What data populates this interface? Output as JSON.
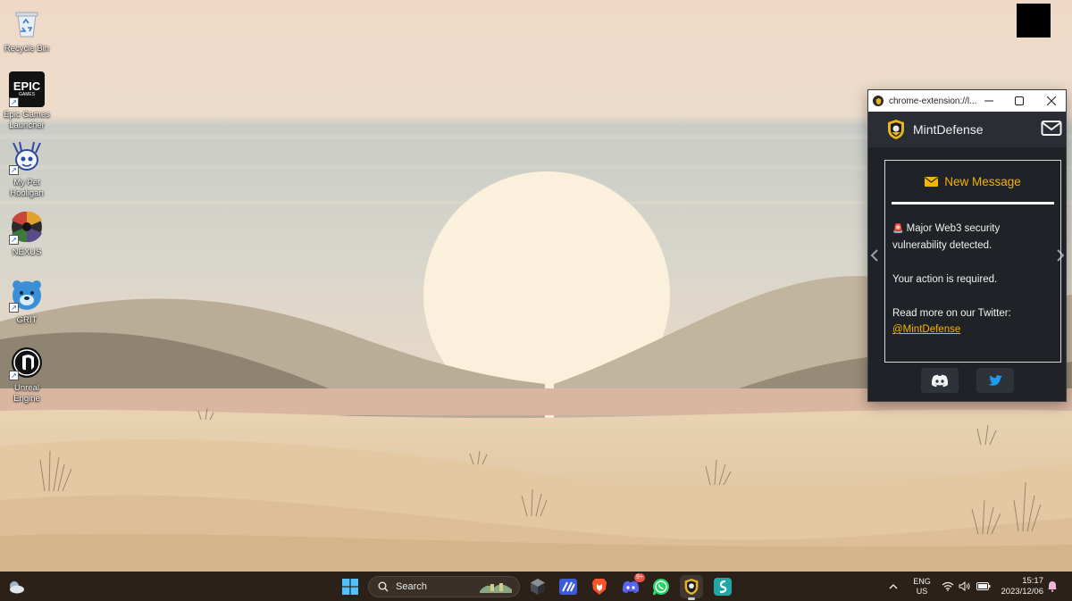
{
  "desktop": {
    "icons": [
      {
        "label": "Recycle Bin",
        "icon": "recycle-bin-icon"
      },
      {
        "label": "Epic Games Launcher",
        "icon": "epic-games-icon"
      },
      {
        "label": "My Pet Hooligan",
        "icon": "pet-hooligan-icon"
      },
      {
        "label": "NEXUS",
        "icon": "nexus-icon"
      },
      {
        "label": "GRIT",
        "icon": "grit-icon"
      },
      {
        "label": "Unreal Engine",
        "icon": "unreal-engine-icon"
      }
    ],
    "epic_tile_text": "EPIC",
    "epic_tile_sub": "GAMES"
  },
  "extension_window": {
    "title": "chrome-extension://l...",
    "header": {
      "brand": "MintDefense"
    },
    "card": {
      "heading": "New Message",
      "alert_icon": "🚨",
      "line1": "Major Web3 security vulnerability detected.",
      "line2": "Your action is required.",
      "line3": "Read more on our Twitter:",
      "twitter_handle": "@MintDefense"
    },
    "accent_color": "#f5b400"
  },
  "taskbar": {
    "search_placeholder": "Search",
    "apps": [
      "windows-start-icon",
      "search",
      "unity-hub-icon",
      "linear-icon",
      "brave-icon",
      "discord-icon",
      "whatsapp-icon",
      "mintdefense-icon",
      "surfshark-icon"
    ],
    "discord_badge": "9+",
    "language": {
      "line1": "ENG",
      "line2": "US"
    },
    "clock": {
      "time": "15:17",
      "date": "2023/12/06"
    }
  }
}
